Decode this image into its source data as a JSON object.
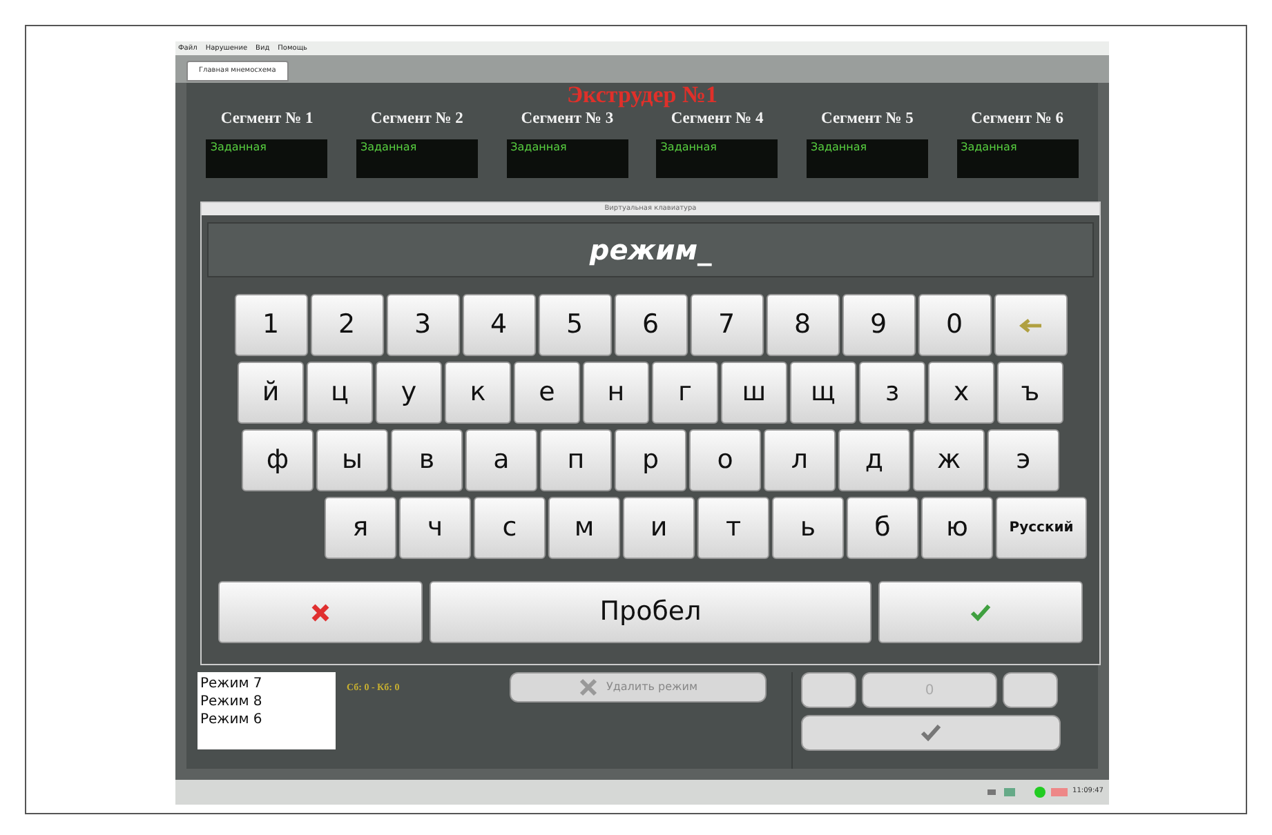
{
  "menu": [
    "Файл",
    "Нарушение",
    "Вид",
    "Помощь"
  ],
  "tabs": [
    {
      "label": "Главная мнемосхема",
      "selected": true
    }
  ],
  "title": "Экструдер №1",
  "segments": [
    {
      "name": "Сегмент № 1",
      "label": "Заданная"
    },
    {
      "name": "Сегмент № 2",
      "label": "Заданная"
    },
    {
      "name": "Сегмент № 3",
      "label": "Заданная"
    },
    {
      "name": "Сегмент № 4",
      "label": "Заданная"
    },
    {
      "name": "Сегмент № 5",
      "label": "Заданная"
    },
    {
      "name": "Сегмент № 6",
      "label": "Заданная"
    }
  ],
  "keyboard": {
    "title": "Виртуальная клавиатура",
    "value": "режим_",
    "rows": [
      {
        "keys": [
          "1",
          "2",
          "3",
          "4",
          "5",
          "6",
          "7",
          "8",
          "9",
          "0"
        ],
        "extra": {
          "kind": "backspace"
        }
      },
      {
        "keys": [
          "й",
          "ц",
          "у",
          "к",
          "е",
          "н",
          "г",
          "ш",
          "щ",
          "з",
          "х",
          "ъ"
        ]
      },
      {
        "keys": [
          "ф",
          "ы",
          "в",
          "а",
          "п",
          "р",
          "о",
          "л",
          "д",
          "ж",
          "э"
        ]
      },
      {
        "keys": [
          "я",
          "ч",
          "с",
          "м",
          "и",
          "т",
          "ь",
          "б",
          "ю"
        ],
        "extra": {
          "kind": "language",
          "label": "Русский"
        }
      }
    ],
    "space": "Пробел"
  },
  "modes": [
    "Режим 7",
    "Режим 8",
    "Режим 6"
  ],
  "counter": "Сб: 0 - Кб: 0",
  "delete_button": "Удалить режим",
  "value_field": "0",
  "clock": "11:09:47"
}
